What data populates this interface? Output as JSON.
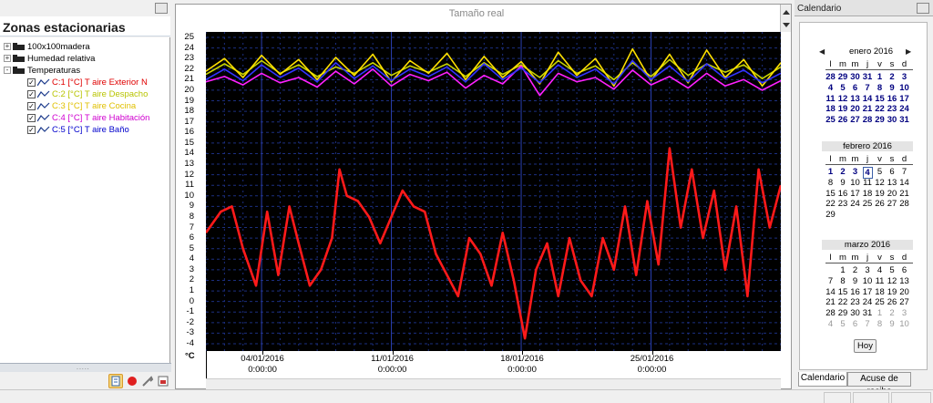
{
  "left_panel": {
    "title": "Zonas estacionarias",
    "tree": [
      {
        "label": "100x100madera",
        "level": 0,
        "expander": "+",
        "color": "#000000"
      },
      {
        "label": "Humedad relativa",
        "level": 0,
        "expander": "+",
        "color": "#000000"
      },
      {
        "label": "Temperaturas",
        "level": 0,
        "expander": "-",
        "color": "#000000"
      },
      {
        "label": "C:1 [°C] T aire Exterior N",
        "level": 1,
        "checked": true,
        "color": "#e00000"
      },
      {
        "label": "C:2 [°C] T aire Despacho",
        "level": 1,
        "checked": true,
        "color": "#b8c400"
      },
      {
        "label": "C:3 [°C] T aire Cocina",
        "level": 1,
        "checked": true,
        "color": "#e0c000"
      },
      {
        "label": "C:4 [°C] T aire Habitación",
        "level": 1,
        "checked": true,
        "color": "#d000d0"
      },
      {
        "label": "C:5 [°C] T aire Baño",
        "level": 1,
        "checked": true,
        "color": "#0000cc"
      }
    ],
    "toolbar_icons": [
      "grid-icon",
      "record-icon",
      "wrench-icon",
      "export-icon"
    ]
  },
  "chart_panel": {
    "title": "Tamaño real"
  },
  "chart_data": {
    "type": "line",
    "title": "Tamaño real",
    "ylabel": "°C",
    "ylim": [
      -4,
      25
    ],
    "yticks": [
      25,
      24,
      23,
      22,
      21,
      20,
      19,
      18,
      17,
      16,
      15,
      14,
      13,
      12,
      11,
      10,
      9,
      8,
      7,
      6,
      5,
      4,
      3,
      2,
      1,
      0,
      -1,
      -2,
      -3,
      -4
    ],
    "x_range_days": [
      0,
      31
    ],
    "xticks": [
      {
        "date": "04/01/2016",
        "time": "0:00:00",
        "day": 3
      },
      {
        "date": "11/01/2016",
        "time": "0:00:00",
        "day": 10
      },
      {
        "date": "18/01/2016",
        "time": "0:00:00",
        "day": 17
      },
      {
        "date": "25/01/2016",
        "time": "0:00:00",
        "day": 24
      }
    ],
    "grid": true,
    "series": [
      {
        "name": "C:1 [°C] T aire Exterior N",
        "color": "#ff1a1a",
        "day": [
          0,
          0.8,
          1.4,
          2.0,
          2.7,
          3.3,
          3.9,
          4.5,
          5.0,
          5.6,
          6.2,
          6.8,
          7.2,
          7.6,
          8.2,
          8.8,
          9.4,
          10.0,
          10.6,
          11.2,
          11.8,
          12.4,
          13.0,
          13.6,
          14.2,
          14.8,
          15.4,
          16.0,
          16.6,
          17.2,
          17.8,
          18.4,
          19.0,
          19.6,
          20.2,
          20.8,
          21.4,
          22.0,
          22.6,
          23.2,
          23.8,
          24.4,
          25.0,
          25.6,
          26.2,
          26.8,
          27.4,
          28.0,
          28.6,
          29.2,
          29.8,
          30.4,
          31.0
        ],
        "values": [
          6.5,
          8.5,
          9.0,
          5.0,
          1.5,
          8.5,
          2.5,
          9.0,
          5.5,
          1.5,
          3.0,
          6.0,
          12.5,
          10.0,
          9.5,
          8.0,
          5.5,
          8.0,
          10.5,
          9.0,
          8.5,
          4.5,
          2.5,
          0.5,
          6.0,
          4.5,
          1.5,
          6.5,
          2.0,
          -3.5,
          3.0,
          5.5,
          0.5,
          6.0,
          2.0,
          0.5,
          6.0,
          3.0,
          9.0,
          2.5,
          9.5,
          3.5,
          14.5,
          7.0,
          12.5,
          6.0,
          10.5,
          3.0,
          9.0,
          0.5,
          12.5,
          7.0,
          11.0
        ]
      },
      {
        "name": "C:2 [°C] T aire Despacho",
        "color": "#c8d400",
        "day": [
          0,
          1,
          2,
          3,
          4,
          5,
          6,
          7,
          8,
          9,
          10,
          11,
          12,
          13,
          14,
          15,
          16,
          17,
          18,
          19,
          20,
          21,
          22,
          23,
          24,
          25,
          26,
          27,
          28,
          29,
          30,
          31
        ],
        "values": [
          21.5,
          22.5,
          21.5,
          22.8,
          21.6,
          22.4,
          21.3,
          22.2,
          21.6,
          22.6,
          21.4,
          22.3,
          21.7,
          22.5,
          21.3,
          22.6,
          21.5,
          22.4,
          21.2,
          22.8,
          21.6,
          22.3,
          21.0,
          22.6,
          21.3,
          22.9,
          21.4,
          22.5,
          21.7,
          22.4,
          21.1,
          22.2
        ]
      },
      {
        "name": "C:3 [°C] T aire Cocina",
        "color": "#ffe000",
        "day": [
          0,
          1,
          2,
          3,
          4,
          5,
          6,
          7,
          8,
          9,
          10,
          11,
          12,
          13,
          14,
          15,
          16,
          17,
          18,
          19,
          20,
          21,
          22,
          23,
          24,
          25,
          26,
          27,
          28,
          29,
          30,
          31
        ],
        "values": [
          21.8,
          23.0,
          21.2,
          23.3,
          21.5,
          22.9,
          21.0,
          23.1,
          21.4,
          23.4,
          20.8,
          22.8,
          21.6,
          23.5,
          21.0,
          23.2,
          21.2,
          22.7,
          20.6,
          23.6,
          21.4,
          23.0,
          20.4,
          23.9,
          20.9,
          23.4,
          20.7,
          23.8,
          21.2,
          22.9,
          20.4,
          22.6
        ]
      },
      {
        "name": "C:4 [°C] T aire Habitación",
        "color": "#ff20ff",
        "day": [
          0,
          1,
          2,
          3,
          4,
          5,
          6,
          7,
          8,
          9,
          10,
          11,
          12,
          13,
          14,
          15,
          16,
          17,
          18,
          19,
          20,
          21,
          22,
          23,
          24,
          25,
          26,
          27,
          28,
          29,
          30,
          31
        ],
        "values": [
          20.8,
          21.3,
          20.5,
          21.6,
          20.7,
          21.2,
          20.3,
          21.8,
          20.6,
          22.0,
          20.4,
          21.5,
          20.9,
          21.7,
          20.2,
          21.4,
          20.6,
          22.3,
          19.5,
          21.6,
          20.8,
          21.2,
          20.1,
          21.9,
          20.5,
          21.3,
          20.2,
          21.6,
          20.4,
          21.0,
          20.0,
          20.9
        ]
      },
      {
        "name": "C:5 [°C] T aire Baño",
        "color": "#3333ff",
        "day": [
          0,
          1,
          2,
          3,
          4,
          5,
          6,
          7,
          8,
          9,
          10,
          11,
          12,
          13,
          14,
          15,
          16,
          17,
          18,
          19,
          20,
          21,
          22,
          23,
          24,
          25,
          26,
          27,
          28,
          29,
          30,
          31
        ],
        "values": [
          21.0,
          22.0,
          20.9,
          22.4,
          21.2,
          22.1,
          20.8,
          22.6,
          21.1,
          22.3,
          20.9,
          22.0,
          21.3,
          22.2,
          20.8,
          22.5,
          21.0,
          22.1,
          20.7,
          22.4,
          21.2,
          22.0,
          20.6,
          22.8,
          21.0,
          22.3,
          20.8,
          22.5,
          21.1,
          21.9,
          20.7,
          21.6
        ]
      }
    ]
  },
  "calendar_panel": {
    "title": "Calendario",
    "weekday_headers": [
      "l",
      "m",
      "m",
      "j",
      "v",
      "s",
      "d"
    ],
    "months": [
      {
        "name": "enero 2016",
        "show_arrows": true,
        "weeks": [
          [
            "28",
            "29",
            "30",
            "31",
            "1",
            "2",
            "3"
          ],
          [
            "4",
            "5",
            "6",
            "7",
            "8",
            "9",
            "10"
          ],
          [
            "11",
            "12",
            "13",
            "14",
            "15",
            "16",
            "17"
          ],
          [
            "18",
            "19",
            "20",
            "21",
            "22",
            "23",
            "24"
          ],
          [
            "25",
            "26",
            "27",
            "28",
            "29",
            "30",
            "31"
          ]
        ],
        "style": "bold"
      },
      {
        "name": "febrero 2016",
        "show_arrows": false,
        "weeks": [
          [
            "1",
            "2",
            "3",
            "4",
            "5",
            "6",
            "7"
          ],
          [
            "8",
            "9",
            "10",
            "11",
            "12",
            "13",
            "14"
          ],
          [
            "15",
            "16",
            "17",
            "18",
            "19",
            "20",
            "21"
          ],
          [
            "22",
            "23",
            "24",
            "25",
            "26",
            "27",
            "28"
          ],
          [
            "29",
            "",
            "",
            "",
            "",
            "",
            ""
          ]
        ],
        "style": "mixed",
        "today": "4"
      },
      {
        "name": "marzo 2016",
        "show_arrows": false,
        "weeks": [
          [
            "",
            "1",
            "2",
            "3",
            "4",
            "5",
            "6"
          ],
          [
            "7",
            "8",
            "9",
            "10",
            "11",
            "12",
            "13"
          ],
          [
            "14",
            "15",
            "16",
            "17",
            "18",
            "19",
            "20"
          ],
          [
            "21",
            "22",
            "23",
            "24",
            "25",
            "26",
            "27"
          ],
          [
            "28",
            "29",
            "30",
            "31",
            "1",
            "2",
            "3"
          ],
          [
            "4",
            "5",
            "6",
            "7",
            "8",
            "9",
            "10"
          ]
        ],
        "style": "normal"
      }
    ],
    "today_button": "Hoy",
    "tabs": [
      "Calendario",
      "Acuse de recibo"
    ],
    "active_tab": "Calendario"
  }
}
